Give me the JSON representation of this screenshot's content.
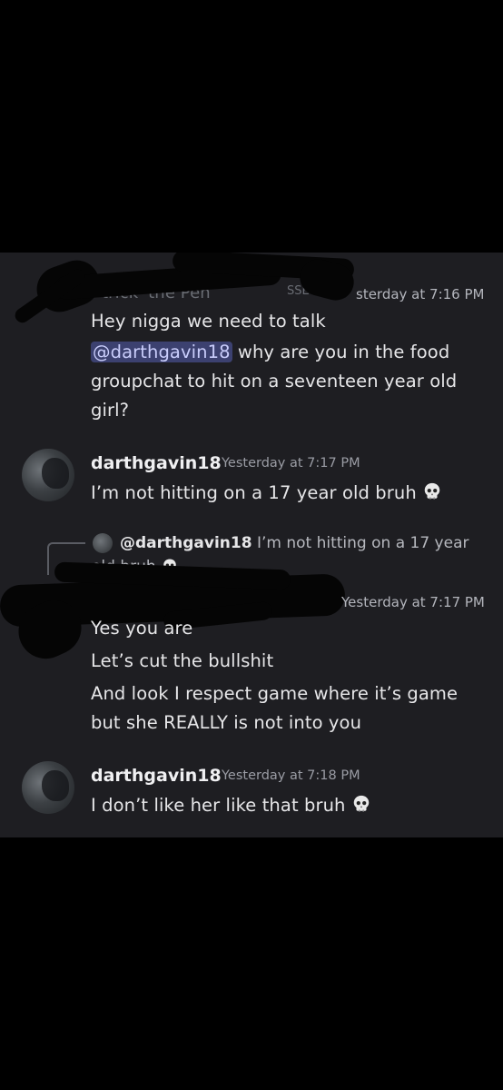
{
  "message1": {
    "username": "trick 'the Pen",
    "tag": "SSE",
    "timestamp": "sterday at 7:16 PM",
    "line1": "Hey nigga we need to talk",
    "mention": "@darthgavin18",
    "line2_rest": " why are you in the food",
    "line3": "groupchat to hit on a seventeen year old",
    "line4": "girl?"
  },
  "message2": {
    "username": "darthgavin18",
    "timestamp": "Yesterday at 7:17 PM",
    "text": "I’m not hitting on a 17 year old bruh"
  },
  "reply": {
    "name": "@darthgavin18",
    "text_rest": " I’m not hitting on a 17 year",
    "text_wrap": "old bruh"
  },
  "message3": {
    "timestamp": "Yesterday at 7:17 PM",
    "line1": "Yes you are",
    "line2": "Let’s cut the bullshit",
    "line3": "And look I respect game where it’s game",
    "line4": "but she REALLY is not into you"
  },
  "message4": {
    "username": "darthgavin18",
    "timestamp": "Yesterday at 7:18 PM",
    "text": "I don’t like her like that bruh"
  },
  "icons": {
    "skull": "skull-emoji",
    "avatar": "user-avatar"
  },
  "colors": {
    "background": "#1e1e22",
    "mention_bg": "#3c4170",
    "mention_fg": "#c9cdfb",
    "timestamp": "#9a9ca4"
  }
}
